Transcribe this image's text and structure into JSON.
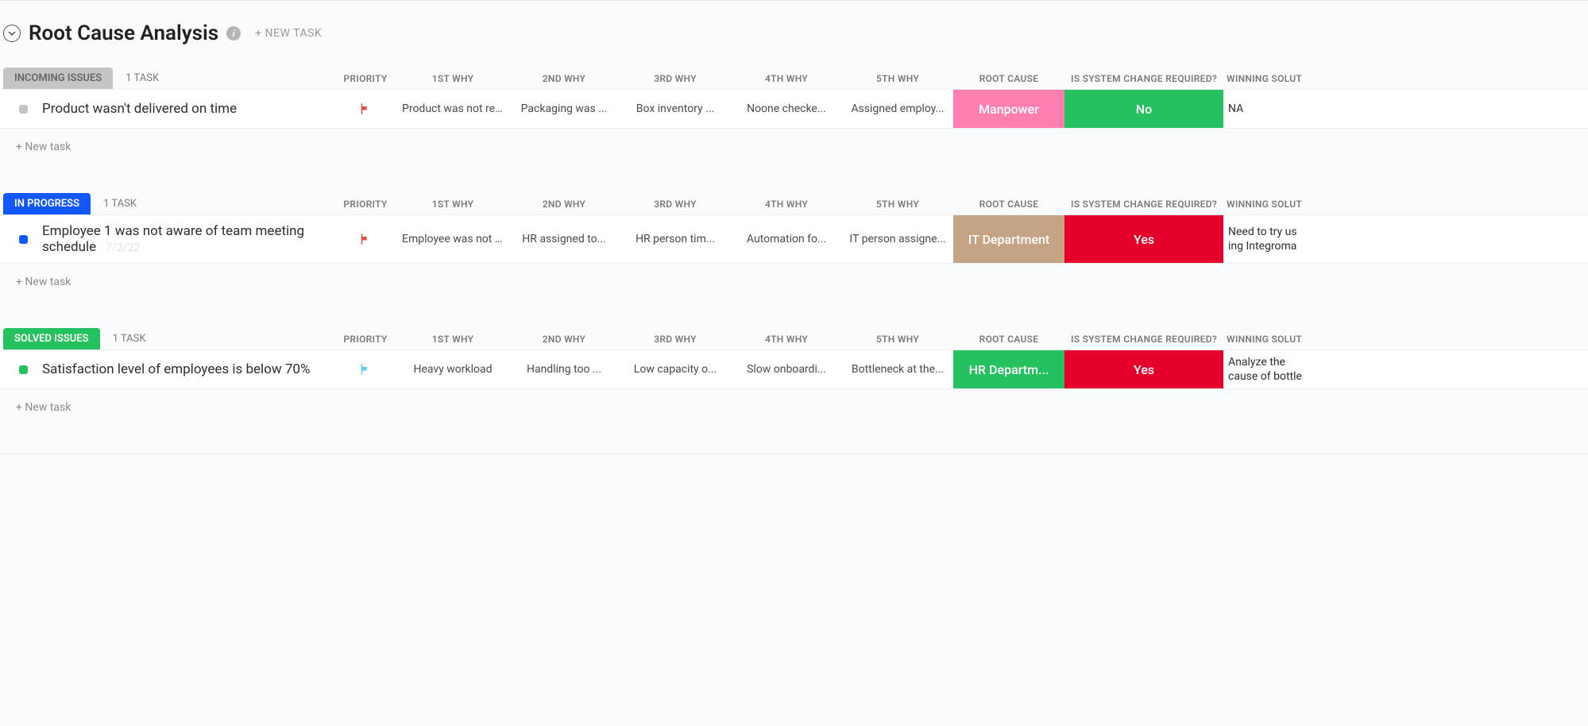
{
  "header": {
    "title": "Root Cause Analysis",
    "new_task_label": "+ NEW TASK"
  },
  "columns": {
    "priority": "PRIORITY",
    "why1": "1ST WHY",
    "why2": "2ND WHY",
    "why3": "3RD WHY",
    "why4": "4TH WHY",
    "why5": "5TH WHY",
    "root_cause": "ROOT CAUSE",
    "sys_change": "IS SYSTEM CHANGE REQUIRED?",
    "winning": "WINNING SOLUT"
  },
  "groups": [
    {
      "status_label": "INCOMING ISSUES",
      "status_class": "grey",
      "count_label": "1 TASK",
      "new_task_label": "+ New task",
      "tasks": [
        {
          "title": "Product wasn't delivered on time",
          "ghost_date": "",
          "priority_class": "flag-red",
          "why1": "Product was not rea...",
          "why2": "Packaging was ...",
          "why3": "Box inventory ...",
          "why4": "Noone checke...",
          "why5": "Assigned employ...",
          "root_cause": "Manpower",
          "root_cause_class": "manpower",
          "sys_change": "No",
          "sys_change_class": "no",
          "winning": "NA"
        }
      ]
    },
    {
      "status_label": "IN PROGRESS",
      "status_class": "blue",
      "count_label": "1 TASK",
      "new_task_label": "+ New task",
      "tasks": [
        {
          "title": "Employee 1 was not aware of team meeting schedule",
          "ghost_date": "7/2/22",
          "priority_class": "flag-red",
          "why1": "Employee was not b...",
          "why2": "HR assigned to...",
          "why3": "HR person tim...",
          "why4": "Automation fo...",
          "why5": "IT person assigne...",
          "root_cause": "IT Department",
          "root_cause_class": "it",
          "sys_change": "Yes",
          "sys_change_class": "yes",
          "winning": "Need to try us ing Integroma"
        }
      ]
    },
    {
      "status_label": "SOLVED ISSUES",
      "status_class": "green",
      "count_label": "1 TASK",
      "new_task_label": "+ New task",
      "tasks": [
        {
          "title": "Satisfaction level of employees is below 70%",
          "ghost_date": "",
          "priority_class": "flag-sky",
          "why1": "Heavy workload",
          "why2": "Handling too ...",
          "why3": "Low capacity o...",
          "why4": "Slow onboardi...",
          "why5": "Bottleneck at the...",
          "root_cause": "HR Departm...",
          "root_cause_class": "hr",
          "sys_change": "Yes",
          "sys_change_class": "yes",
          "winning": "Analyze the cause of bottle"
        }
      ]
    }
  ]
}
